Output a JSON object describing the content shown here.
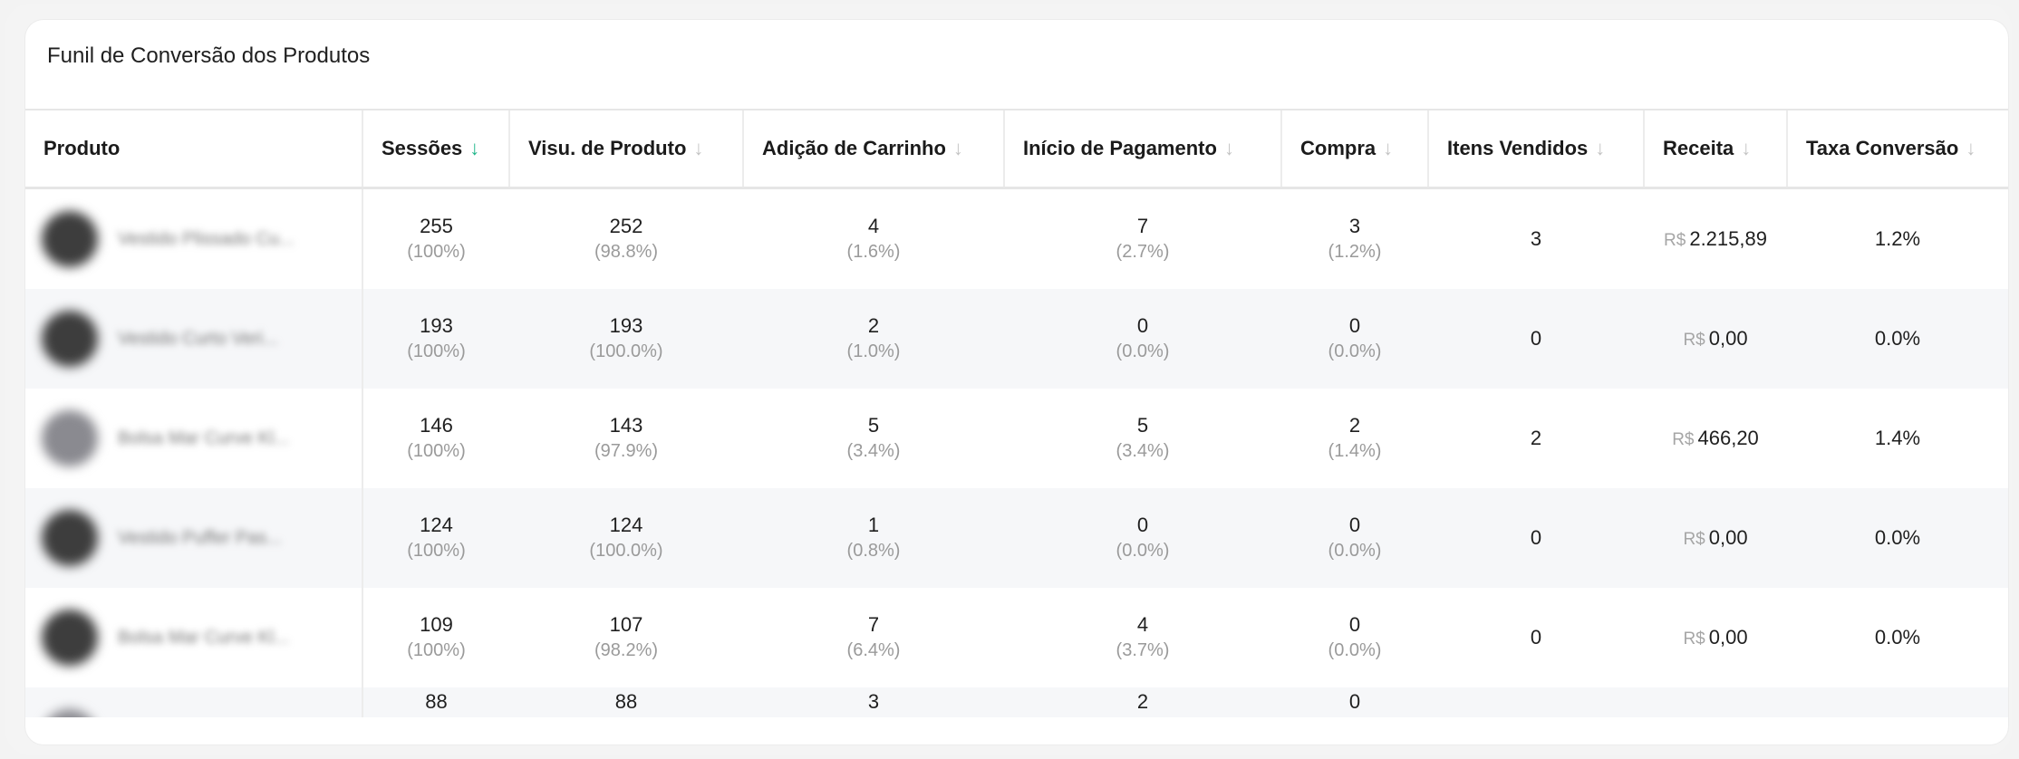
{
  "card": {
    "title": "Funil de Conversão dos Produtos"
  },
  "columns": [
    {
      "label": "Produto"
    },
    {
      "label": "Sessões",
      "sort": "active"
    },
    {
      "label": "Visu. de Produto"
    },
    {
      "label": "Adição de Carrinho"
    },
    {
      "label": "Início de Pagamento"
    },
    {
      "label": "Compra"
    },
    {
      "label": "Itens Vendidos"
    },
    {
      "label": "Receita"
    },
    {
      "label": "Taxa Conversão"
    }
  ],
  "currency_symbol": "R$",
  "rows": [
    {
      "name": "Vestido Plissado Cu...",
      "sessoes": {
        "v": "255",
        "p": "(100%)"
      },
      "visu": {
        "v": "252",
        "p": "(98.8%)"
      },
      "carrinho": {
        "v": "4",
        "p": "(1.6%)"
      },
      "pagamento": {
        "v": "7",
        "p": "(2.7%)"
      },
      "compra": {
        "v": "3",
        "p": "(1.2%)"
      },
      "itens": "3",
      "receita": "2.215,89",
      "taxa": "1.2%"
    },
    {
      "name": "Vestido Curto Veri...",
      "sessoes": {
        "v": "193",
        "p": "(100%)"
      },
      "visu": {
        "v": "193",
        "p": "(100.0%)"
      },
      "carrinho": {
        "v": "2",
        "p": "(1.0%)"
      },
      "pagamento": {
        "v": "0",
        "p": "(0.0%)"
      },
      "compra": {
        "v": "0",
        "p": "(0.0%)"
      },
      "itens": "0",
      "receita": "0,00",
      "taxa": "0.0%"
    },
    {
      "name": "Bolsa Mar Curve Kl...",
      "sessoes": {
        "v": "146",
        "p": "(100%)"
      },
      "visu": {
        "v": "143",
        "p": "(97.9%)"
      },
      "carrinho": {
        "v": "5",
        "p": "(3.4%)"
      },
      "pagamento": {
        "v": "5",
        "p": "(3.4%)"
      },
      "compra": {
        "v": "2",
        "p": "(1.4%)"
      },
      "itens": "2",
      "receita": "466,20",
      "taxa": "1.4%"
    },
    {
      "name": "Vestido Puffer Pas...",
      "sessoes": {
        "v": "124",
        "p": "(100%)"
      },
      "visu": {
        "v": "124",
        "p": "(100.0%)"
      },
      "carrinho": {
        "v": "1",
        "p": "(0.8%)"
      },
      "pagamento": {
        "v": "0",
        "p": "(0.0%)"
      },
      "compra": {
        "v": "0",
        "p": "(0.0%)"
      },
      "itens": "0",
      "receita": "0,00",
      "taxa": "0.0%"
    },
    {
      "name": "Bolsa Mar Curve Kl...",
      "sessoes": {
        "v": "109",
        "p": "(100%)"
      },
      "visu": {
        "v": "107",
        "p": "(98.2%)"
      },
      "carrinho": {
        "v": "7",
        "p": "(6.4%)"
      },
      "pagamento": {
        "v": "4",
        "p": "(3.7%)"
      },
      "compra": {
        "v": "0",
        "p": "(0.0%)"
      },
      "itens": "0",
      "receita": "0,00",
      "taxa": "0.0%"
    }
  ],
  "partial_row": {
    "sessoes": "88",
    "visu": "88",
    "carrinho": "3",
    "pagamento": "2",
    "compra": "0"
  },
  "colors": {
    "sort_active": "#1fb589",
    "sort_inactive": "#c4c4c4",
    "row_alt": "#f6f7f9"
  },
  "icons": {
    "sort_arrow": "arrow-down-icon",
    "thumbnail": "product-thumbnail"
  }
}
